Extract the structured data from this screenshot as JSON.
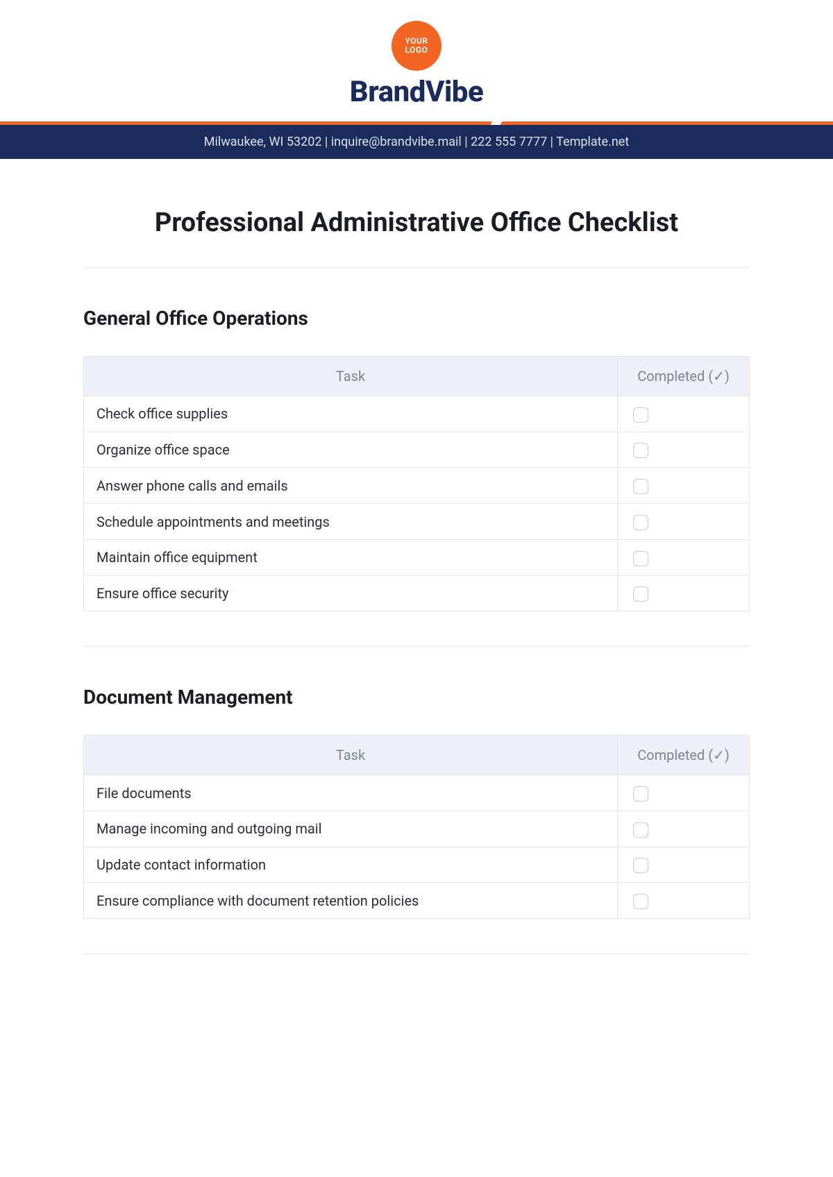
{
  "header": {
    "logo_line1": "YOUR",
    "logo_line2": "LOGO",
    "brand": "BrandVibe",
    "info": "Milwaukee, WI 53202  |  inquire@brandvibe.mail  |  222 555 7777  |  Template.net"
  },
  "title": "Professional Administrative Office Checklist",
  "table_headers": {
    "task": "Task",
    "completed": "Completed (✓)"
  },
  "sections": [
    {
      "heading": "General Office Operations",
      "tasks": [
        "Check office supplies",
        "Organize office space",
        "Answer phone calls and emails",
        "Schedule appointments and meetings",
        "Maintain office equipment",
        "Ensure office security"
      ]
    },
    {
      "heading": "Document Management",
      "tasks": [
        "File documents",
        "Manage incoming and outgoing mail",
        "Update contact information",
        "Ensure compliance with document retention policies"
      ]
    }
  ]
}
